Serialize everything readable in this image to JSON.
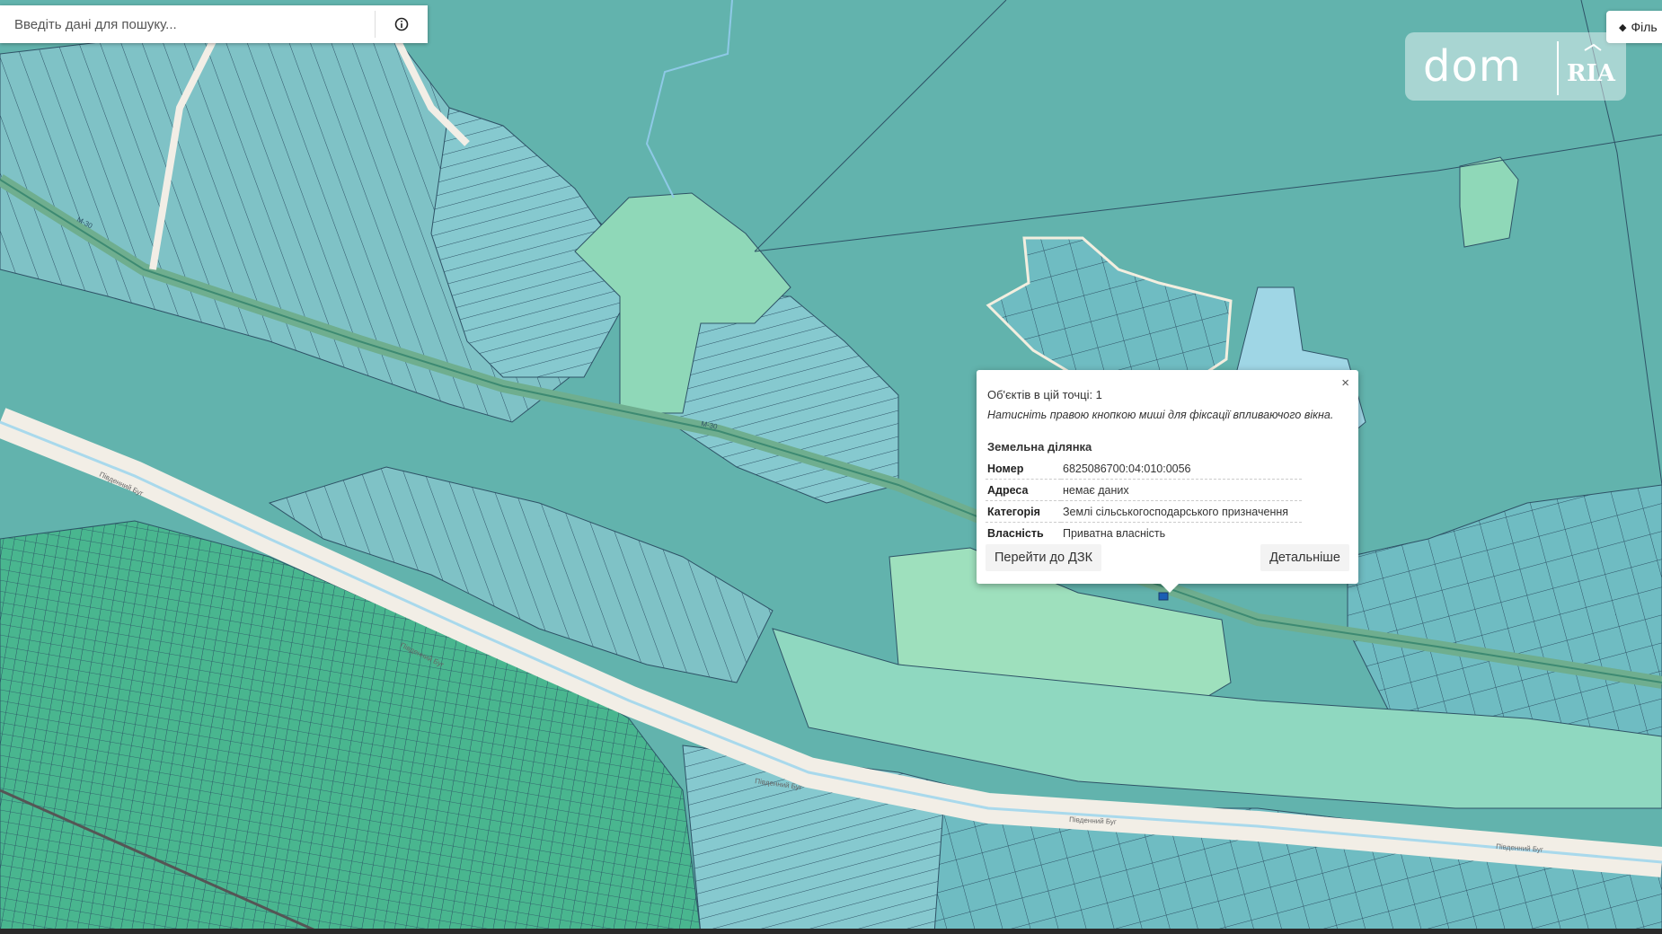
{
  "search": {
    "placeholder": "Введіть дані для пошуку..."
  },
  "filter_button": {
    "label": "Філь"
  },
  "logo": {
    "dom": "dom",
    "ria": "RIA"
  },
  "popup": {
    "close": "×",
    "count": "Об'єктів в цій точці: 1",
    "hint": "Натисніть правою кнопкою миші для фіксації впливаючого вікна.",
    "title": "Земельна ділянка",
    "rows": [
      {
        "key": "Номер",
        "value": "6825086700:04:010:0056"
      },
      {
        "key": "Адреса",
        "value": "немає даних"
      },
      {
        "key": "Категорія",
        "value": "Землі сільськогосподарського призначення"
      },
      {
        "key": "Власність",
        "value": "Приватна власність"
      }
    ],
    "dzk_button": "Перейти до ДЗК",
    "details_button": "Детальніше"
  },
  "map_labels": [
    "М-30",
    "М-30",
    "Південний Буг",
    "Південний Буг",
    "Південний Буг",
    "Південний Буг",
    "Південний Буг"
  ],
  "colors": {
    "water_forest": "#62b3ad",
    "parcel_fill": "#7fc2c6",
    "parcel_line": "#2e5266",
    "urban_fill": "#45b88f",
    "meadow": "#8fd8b8",
    "road": "#f2eee6",
    "river": "#a9d9ec"
  }
}
